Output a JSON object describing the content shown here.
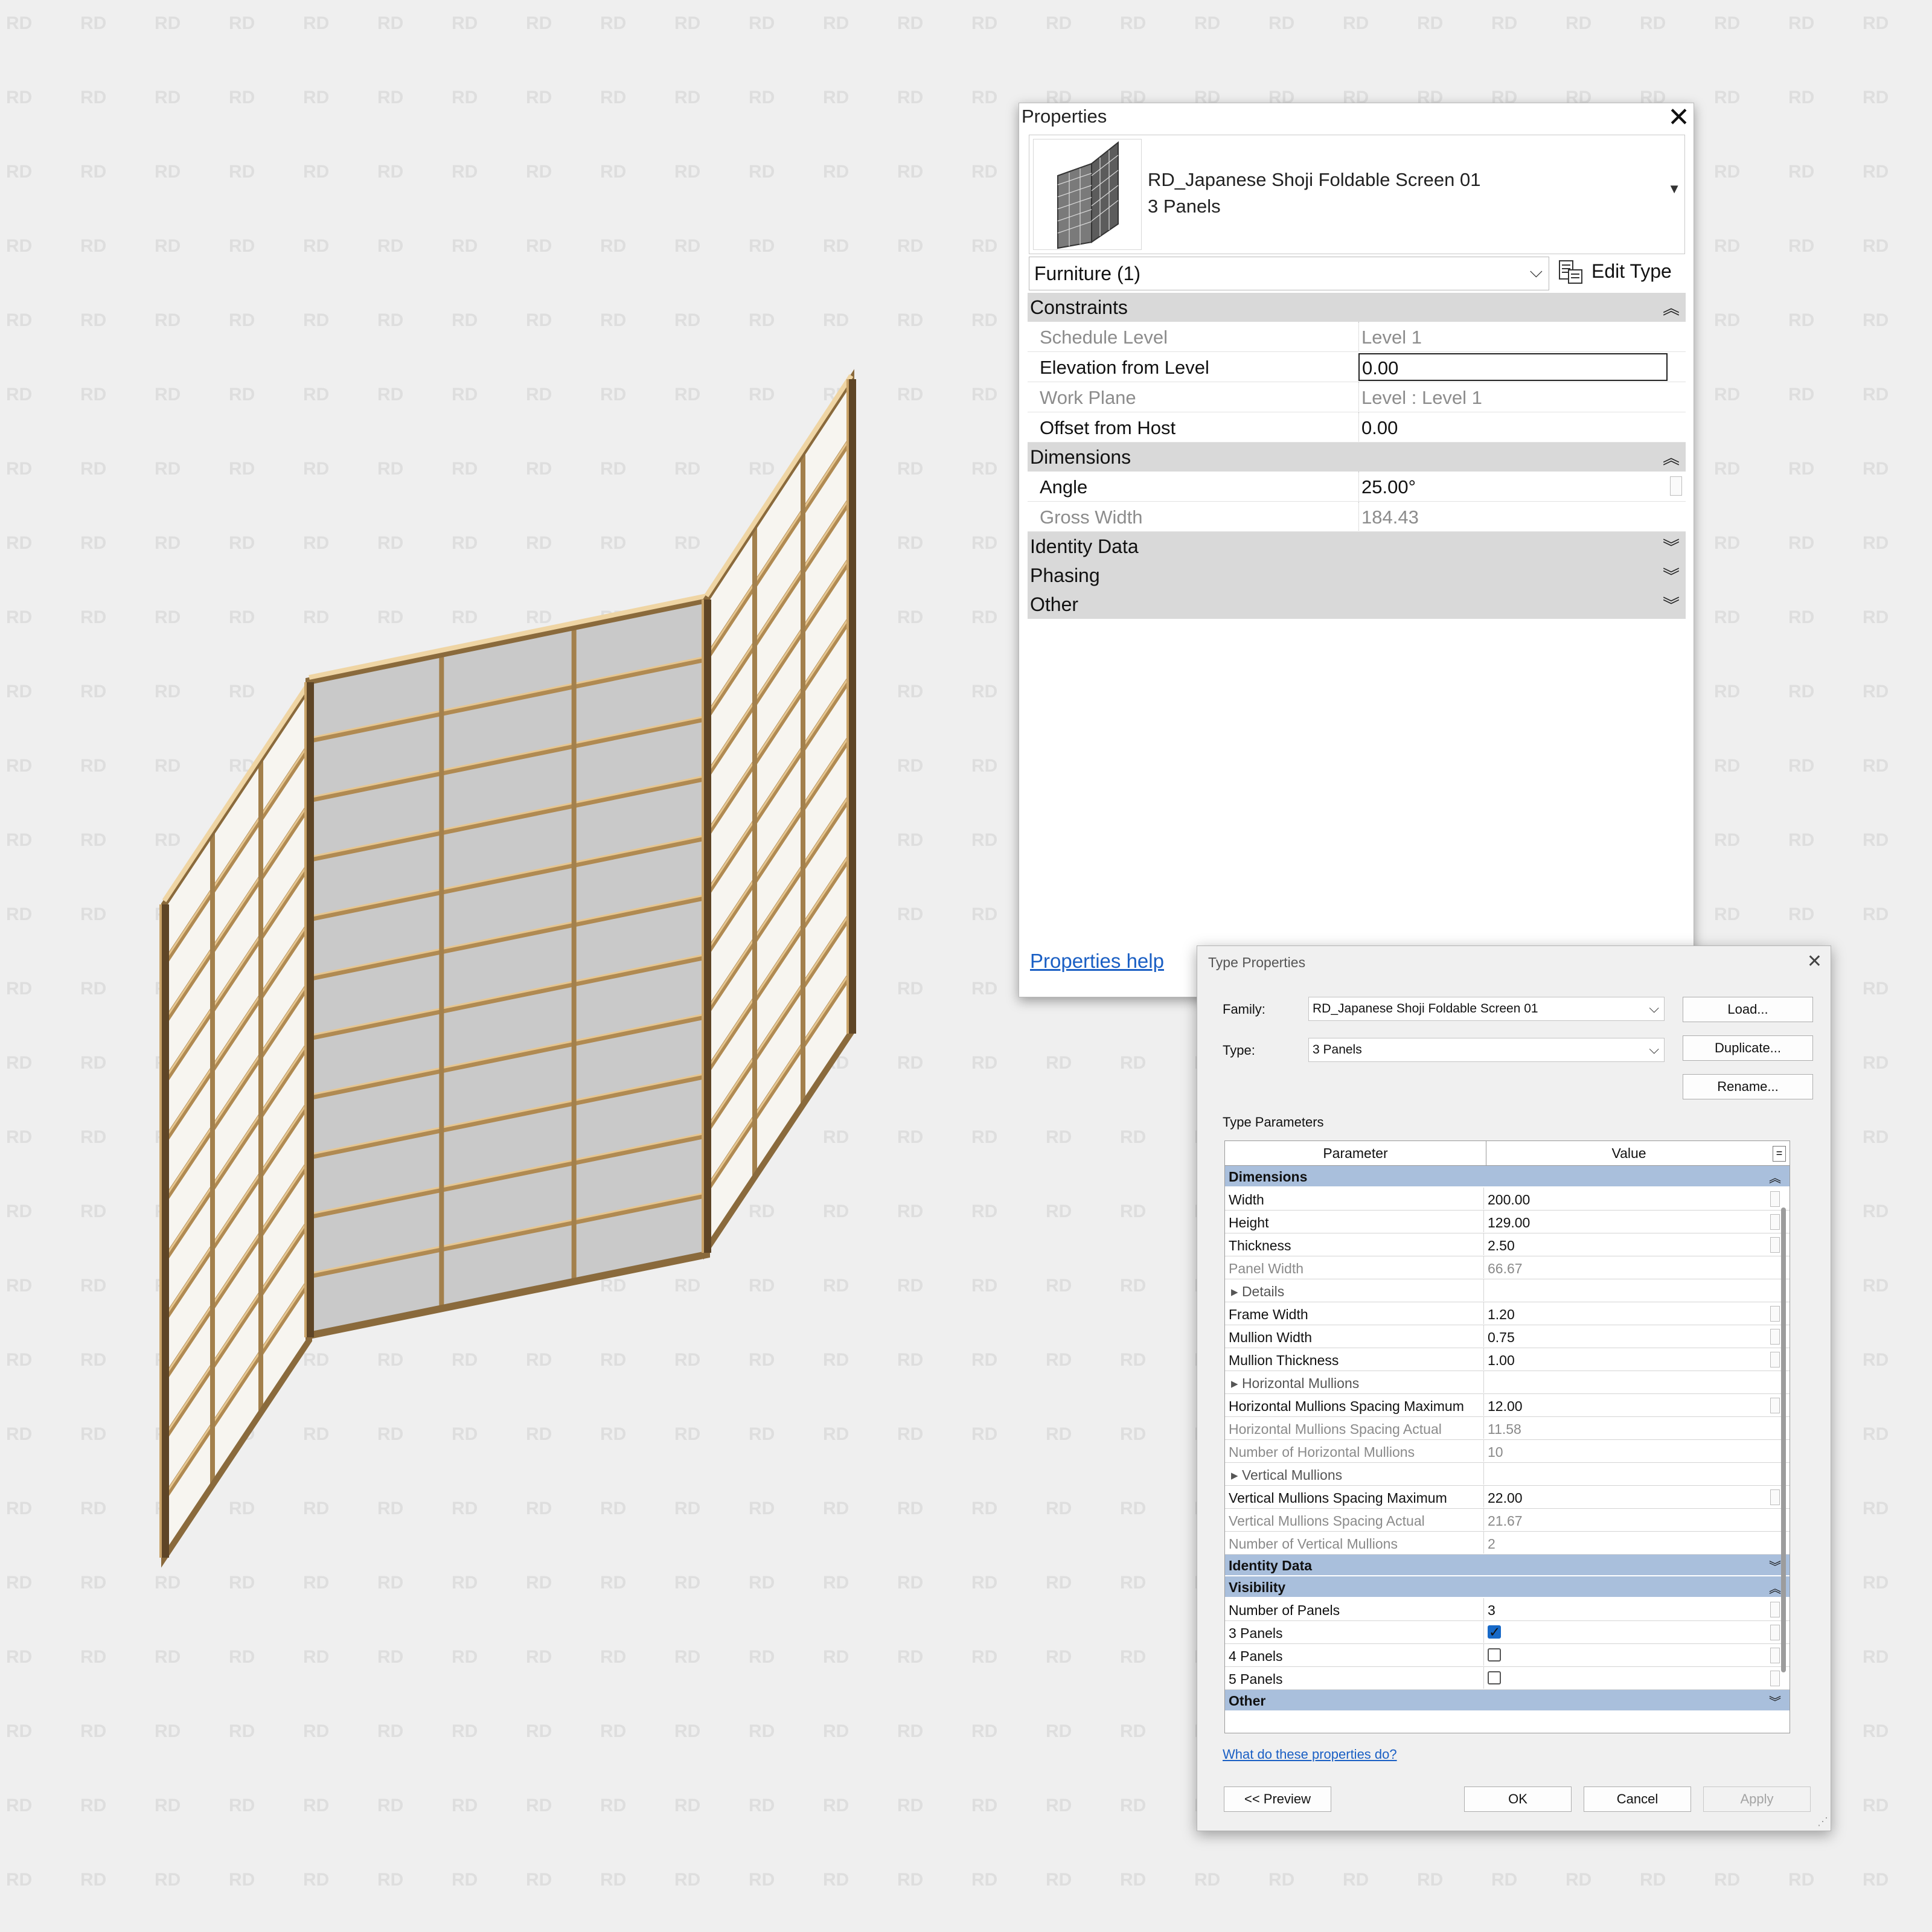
{
  "watermark": "RD",
  "model": {
    "name": "Japanese Shoji Foldable Screen",
    "panel_count": 3
  },
  "properties": {
    "title": "Properties",
    "type_name_line1": "RD_Japanese Shoji Foldable Screen 01",
    "type_name_line2": "3 Panels",
    "category": "Furniture (1)",
    "edit_type": "Edit Type",
    "groups": {
      "constraints": "Constraints",
      "dimensions": "Dimensions",
      "identity": "Identity Data",
      "phasing": "Phasing",
      "other": "Other"
    },
    "rows": {
      "schedule_level": {
        "name": "Schedule Level",
        "value": "Level 1"
      },
      "elevation": {
        "name": "Elevation from Level",
        "value": "0.00"
      },
      "work_plane": {
        "name": "Work Plane",
        "value": "Level : Level 1"
      },
      "offset": {
        "name": "Offset from Host",
        "value": "0.00"
      },
      "angle": {
        "name": "Angle",
        "value": "25.00°"
      },
      "gross_width": {
        "name": "Gross Width",
        "value": "184.43"
      }
    },
    "help": "Properties help"
  },
  "type_properties": {
    "title": "Type Properties",
    "family_label": "Family:",
    "family_value": "RD_Japanese Shoji Foldable Screen 01",
    "type_label": "Type:",
    "type_value": "3 Panels",
    "load": "Load...",
    "duplicate": "Duplicate...",
    "rename": "Rename...",
    "type_parameters": "Type Parameters",
    "col_parameter": "Parameter",
    "col_value": "Value",
    "col_equals": "=",
    "groups": {
      "dimensions": "Dimensions",
      "identity": "Identity Data",
      "visibility": "Visibility",
      "other": "Other"
    },
    "rows": {
      "width": {
        "name": "Width",
        "value": "200.00"
      },
      "height": {
        "name": "Height",
        "value": "129.00"
      },
      "thickness": {
        "name": "Thickness",
        "value": "2.50"
      },
      "panel_width": {
        "name": "Panel Width",
        "value": "66.67"
      },
      "details": {
        "name": "Details"
      },
      "frame_width": {
        "name": "Frame Width",
        "value": "1.20"
      },
      "mullion_width": {
        "name": "Mullion Width",
        "value": "0.75"
      },
      "mullion_thickness": {
        "name": "Mullion Thickness",
        "value": "1.00"
      },
      "horizontal_mullions": {
        "name": "Horizontal Mullions"
      },
      "h_spacing_max": {
        "name": "Horizontal Mullions Spacing Maximum",
        "value": "12.00"
      },
      "h_spacing_actual": {
        "name": "Horizontal Mullions Spacing Actual",
        "value": "11.58"
      },
      "h_count": {
        "name": "Number of Horizontal Mullions",
        "value": "10"
      },
      "vertical_mullions": {
        "name": "Vertical Mullions"
      },
      "v_spacing_max": {
        "name": "Vertical Mullions Spacing Maximum",
        "value": "22.00"
      },
      "v_spacing_actual": {
        "name": "Vertical Mullions Spacing Actual",
        "value": "21.67"
      },
      "v_count": {
        "name": "Number of Vertical Mullions",
        "value": "2"
      },
      "num_panels": {
        "name": "Number of Panels",
        "value": "3"
      },
      "p3": {
        "name": "3 Panels",
        "checked": true
      },
      "p4": {
        "name": "4 Panels",
        "checked": false
      },
      "p5": {
        "name": "5 Panels",
        "checked": false
      }
    },
    "help": "What do these properties do?",
    "preview": "<< Preview",
    "ok": "OK",
    "cancel": "Cancel",
    "apply": "Apply"
  }
}
